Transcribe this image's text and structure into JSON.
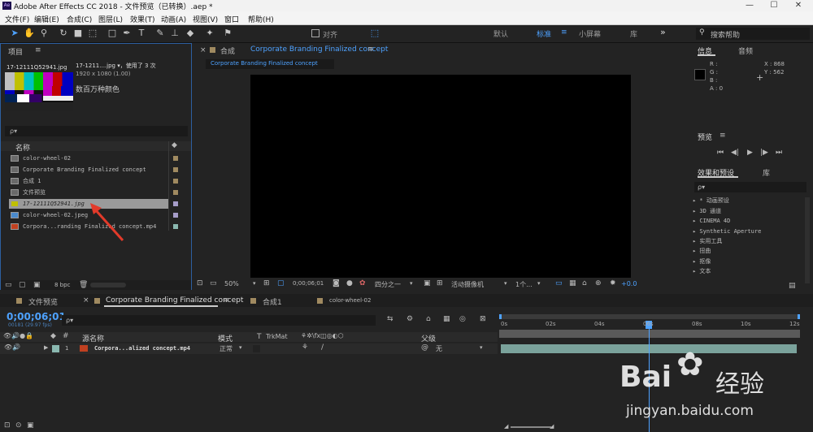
{
  "window": {
    "title": "Adobe After Effects CC 2018 - 文件预览（已转换）.aep *",
    "min": "—",
    "max": "☐",
    "close": "✕"
  },
  "menu": [
    "文件(F)",
    "编辑(E)",
    "合成(C)",
    "图层(L)",
    "效果(T)",
    "动画(A)",
    "视图(V)",
    "窗口",
    "帮助(H)"
  ],
  "toolbar": {
    "align_label": "对齐",
    "workspaces": [
      "默认",
      "标准",
      "小屏幕",
      "库"
    ],
    "search_help": "搜索帮助",
    "expand": "»"
  },
  "project": {
    "title": "项目",
    "selected": {
      "name": "17-12111Q52941.jpg",
      "short": "17-1211....jpg ▾，使用了 3 次",
      "dims": "1920 x 1080 (1.00)",
      "colors": "数百万种颜色"
    },
    "search_placeholder": "ρ▾",
    "col_name": "名称",
    "items": [
      {
        "name": "color-wheel-02",
        "color": "#a08a60"
      },
      {
        "name": "Corporate Branding  Finalized concept",
        "color": "#a08a60"
      },
      {
        "name": "合成 1",
        "color": "#a08a60"
      },
      {
        "name": "文件预览",
        "color": "#a08a60"
      },
      {
        "name": "17-12111Q52941.jpg",
        "color": "#a69dc9"
      },
      {
        "name": "color-wheel-02.jpeg",
        "color": "#a69dc9"
      },
      {
        "name": "Corpora...randing  Finalized concept.mp4",
        "color": "#8ab8b0"
      }
    ],
    "bpc": "8 bpc"
  },
  "comp": {
    "label": "合成",
    "name": "Corporate Branding  Finalized concept",
    "tab": "Corporate Branding  Finalized concept",
    "zoom": "50%",
    "time": "0;00;06;01",
    "quality": "四分之一",
    "camera": "活动摄像机",
    "views": "1个...",
    "offset": "+0.0"
  },
  "info": {
    "title": "信息",
    "audio": "音频",
    "r": "R :",
    "g": "G :",
    "b": "B :",
    "a": "A : 0",
    "x": "X : 868",
    "y": "Y : 562"
  },
  "preview": {
    "title": "预览"
  },
  "effects": {
    "title": "效果和预设",
    "lib": "库",
    "search": "ρ▾",
    "items": [
      "▸ * 动画预设",
      "▸ 3D 通道",
      "▸ CINEMA 4D",
      "▸ Synthetic Aperture",
      "▸ 实用工具",
      "▸ 扭曲",
      "▸ 抠像",
      "▸ 文本"
    ]
  },
  "timeline": {
    "tabs": [
      "文件预览",
      "Corporate Branding  Finalized concept",
      "合成1",
      "color-wheel-02"
    ],
    "time": "0;00;06;01",
    "frames": "00181 (29.97 fps)",
    "search": "ρ▾",
    "col_source": "源名称",
    "col_mode": "模式",
    "col_t": "T",
    "col_trkmat": "TrkMat",
    "col_parent": "父级",
    "layer": {
      "num": "1",
      "name": "Corpora...alized concept.mp4",
      "mode": "正常",
      "parent": "无"
    },
    "ticks": [
      "0s",
      "02s",
      "04s",
      "06s",
      "08s",
      "10s",
      "12s"
    ]
  },
  "watermark": {
    "brand": "Bai",
    "sub": "经验",
    "url": "jingyan.baidu.com"
  }
}
